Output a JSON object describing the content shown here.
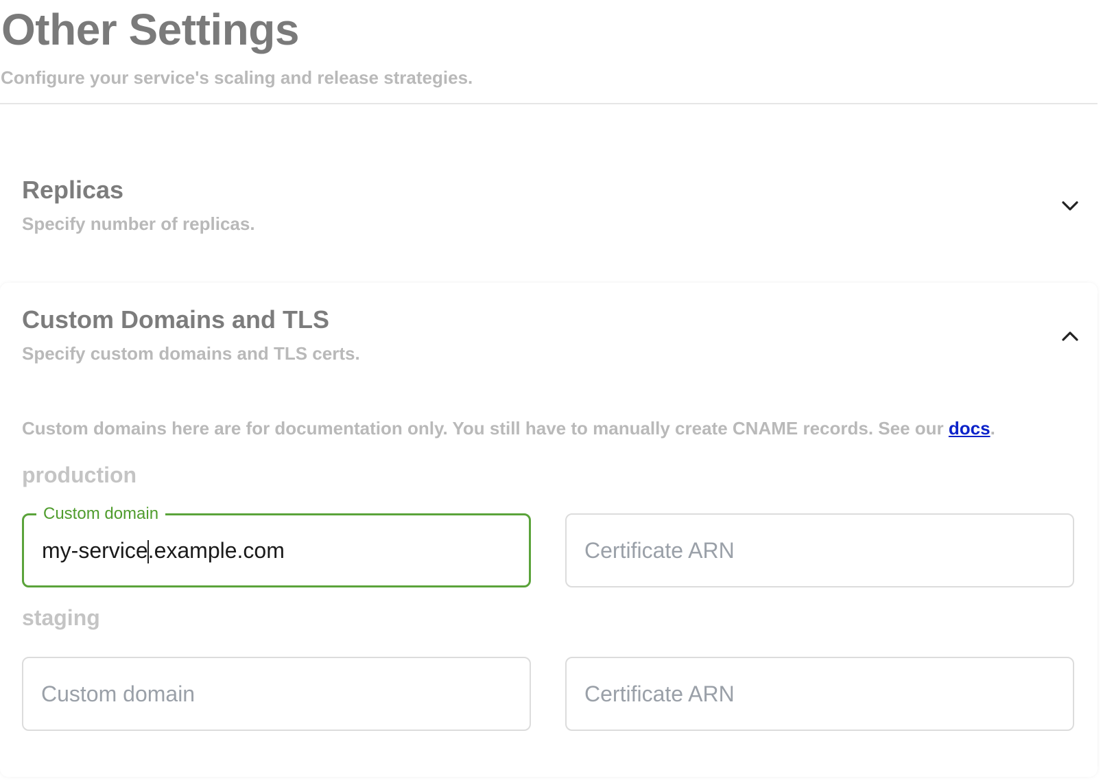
{
  "header": {
    "title": "Other Settings",
    "subtitle": "Configure your service's scaling and release strategies."
  },
  "replicas": {
    "title": "Replicas",
    "description": "Specify number of replicas.",
    "chevron_icon": "chevron-down-icon",
    "expanded": false
  },
  "domains": {
    "title": "Custom Domains and TLS",
    "description": "Specify custom domains and TLS certs.",
    "chevron_icon": "chevron-up-icon",
    "expanded": true,
    "notice_text": "Custom domains here are for documentation only. You still have to manually create CNAME records. See our ",
    "notice_link": "docs",
    "notice_end": ".",
    "environments": [
      {
        "name": "production",
        "domain": {
          "label": "Custom domain",
          "value": "my-service.example.com",
          "placeholder": "Custom domain"
        },
        "cert": {
          "value": "",
          "placeholder": "Certificate ARN"
        }
      },
      {
        "name": "staging",
        "domain": {
          "value": "",
          "placeholder": "Custom domain"
        },
        "cert": {
          "value": "",
          "placeholder": "Certificate ARN"
        }
      }
    ]
  },
  "colors": {
    "focus_border": "#5aa33a",
    "link": "#0b22c9",
    "muted_text": "#b9b9b9",
    "title_text": "#7a7a7a"
  }
}
